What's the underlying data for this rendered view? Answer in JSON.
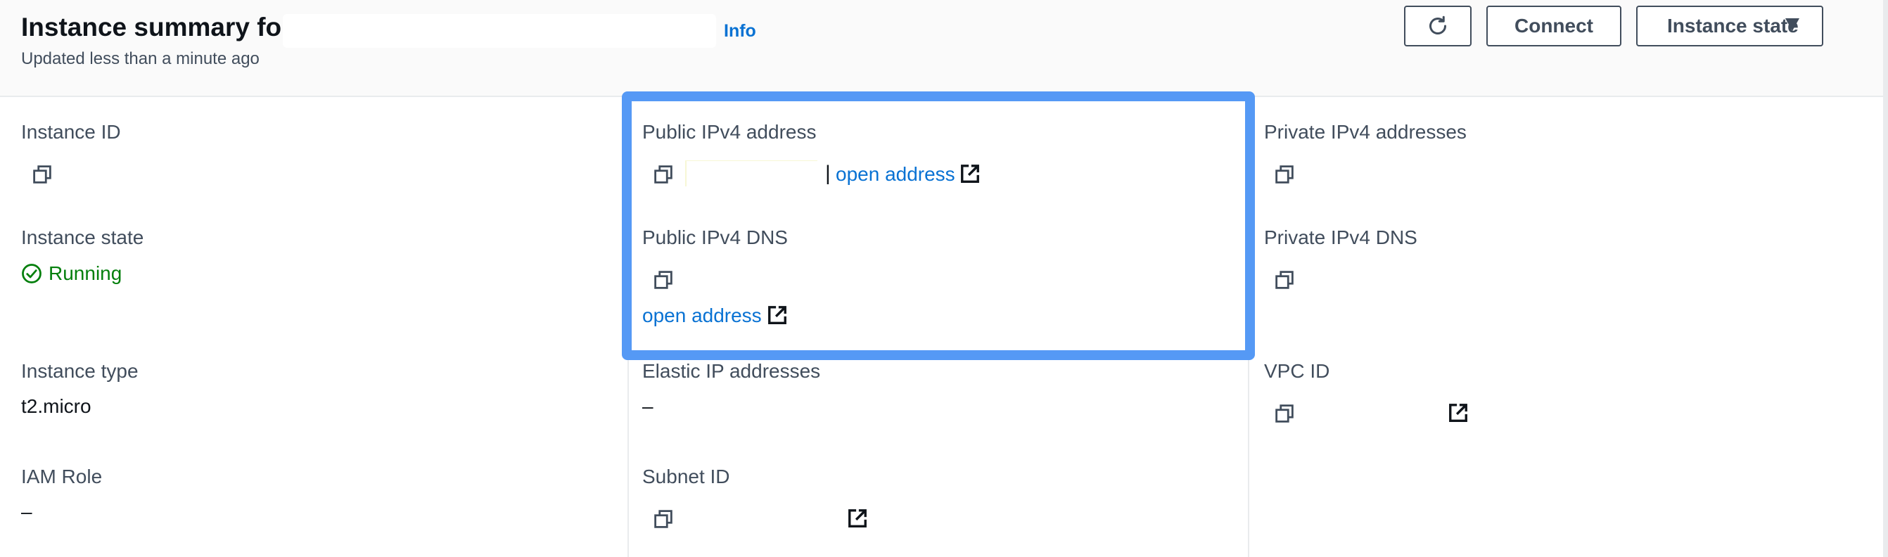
{
  "header": {
    "title": "Instance summary for",
    "info_link": "Info",
    "updated": "Updated less than a minute ago",
    "buttons": {
      "connect": "Connect",
      "instance_state": "Instance state"
    }
  },
  "fields": {
    "instance_id_label": "Instance ID",
    "public_ipv4_address_label": "Public IPv4 address",
    "private_ipv4_addresses_label": "Private IPv4 addresses",
    "instance_state_label": "Instance state",
    "instance_state_value": "Running",
    "public_ipv4_dns_label": "Public IPv4 DNS",
    "private_ipv4_dns_label": "Private IPv4 DNS",
    "instance_type_label": "Instance type",
    "instance_type_value": "t2.micro",
    "elastic_ip_label": "Elastic IP addresses",
    "elastic_ip_value": "–",
    "vpc_id_label": "VPC ID",
    "iam_role_label": "IAM Role",
    "iam_role_value": "–",
    "subnet_id_label": "Subnet ID",
    "open_address_link": "open address",
    "separator": "|"
  },
  "colors": {
    "link": "#0972d3",
    "running": "#037f0c",
    "highlight": "#5599f5"
  },
  "icons": [
    "refresh-icon",
    "caret-down-icon",
    "copy-icon",
    "external-link-icon",
    "check-circle-icon"
  ]
}
